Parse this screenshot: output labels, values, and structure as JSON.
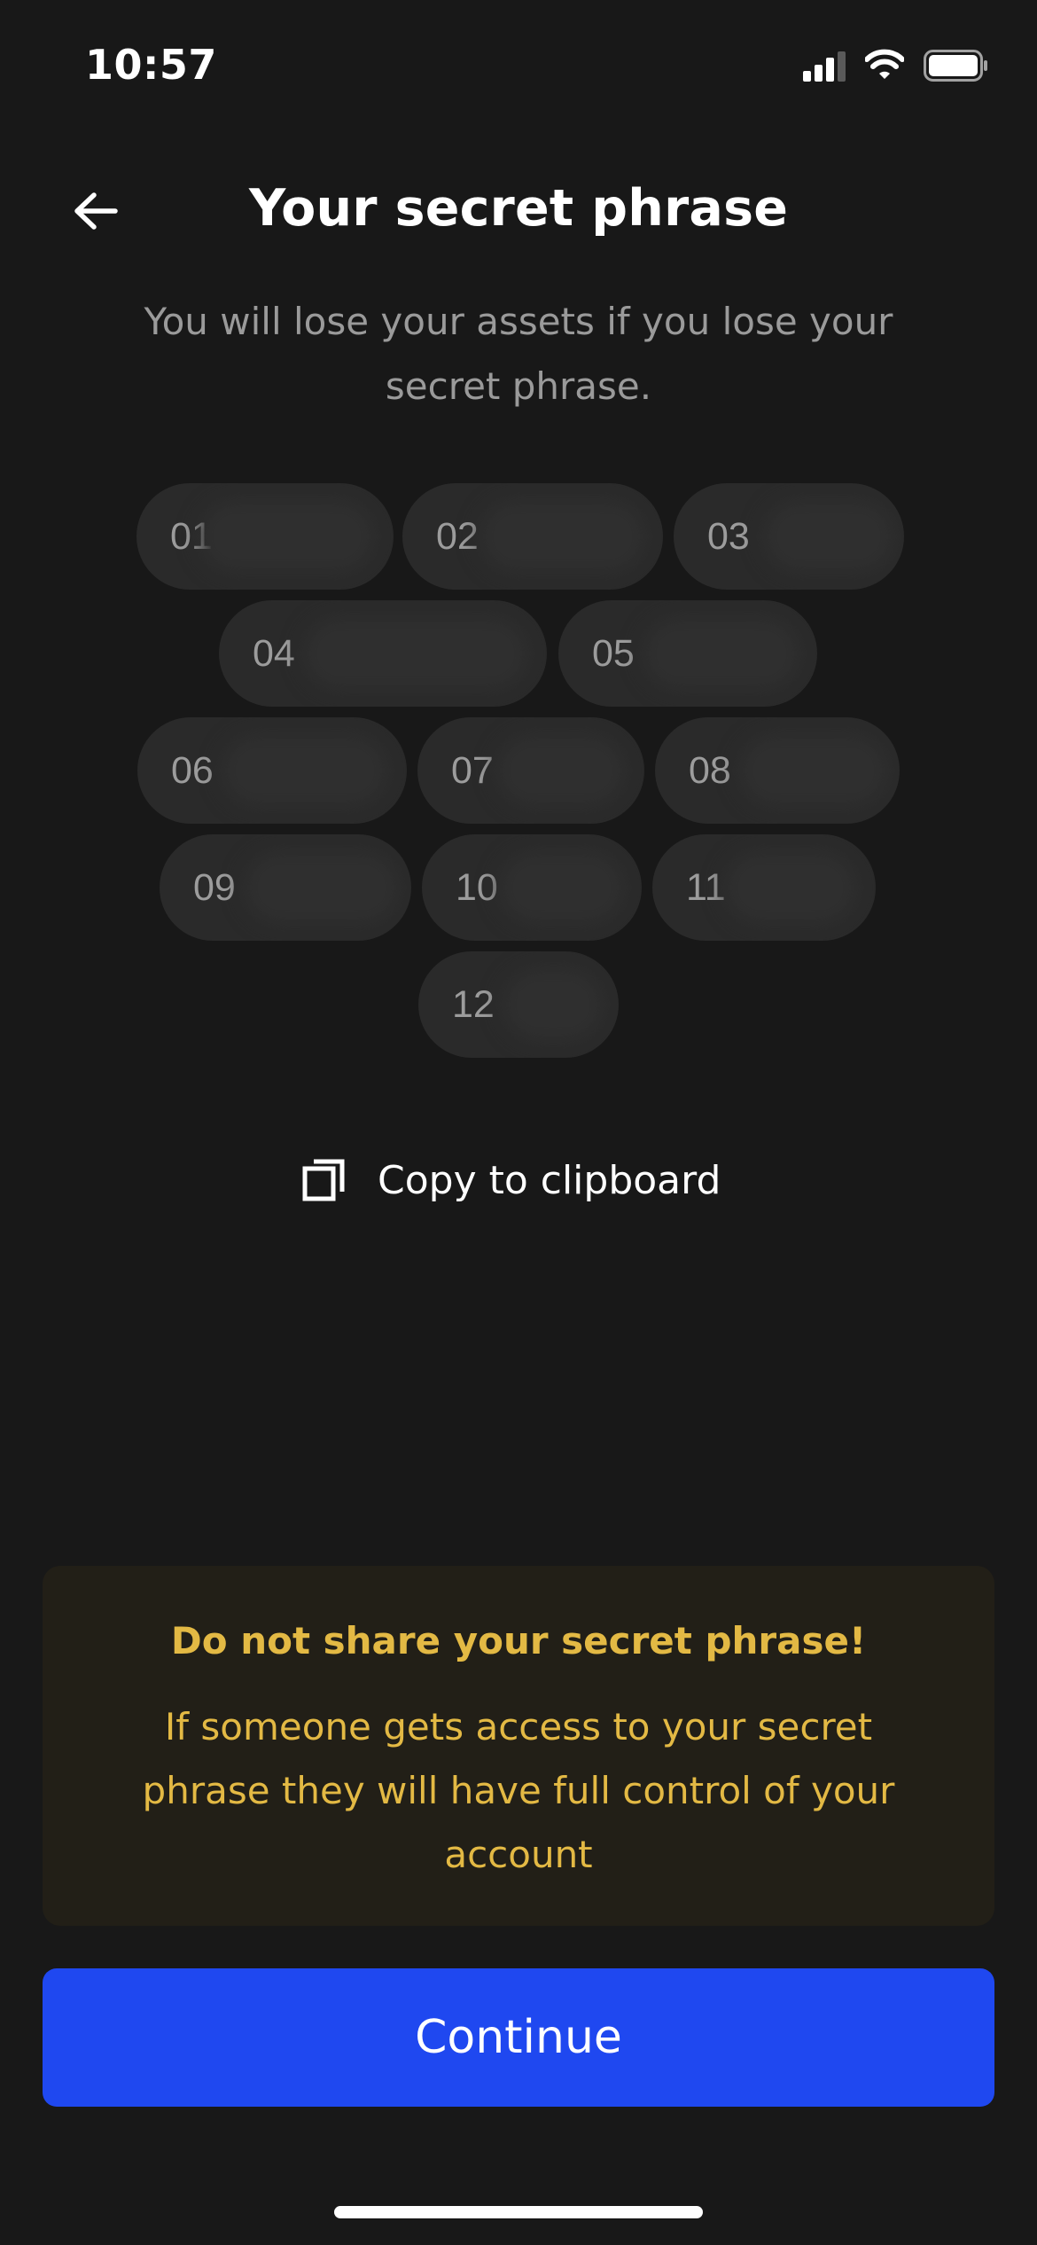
{
  "status_bar": {
    "time": "10:57",
    "icons": [
      "cellular-signal-icon",
      "wifi-icon",
      "battery-icon"
    ]
  },
  "header": {
    "back_icon": "arrow-left-icon",
    "title": "Your secret phrase"
  },
  "subtitle": "You will lose your assets if you lose your secret phrase.",
  "phrase_words": [
    {
      "number": "01"
    },
    {
      "number": "02"
    },
    {
      "number": "03"
    },
    {
      "number": "04"
    },
    {
      "number": "05"
    },
    {
      "number": "06"
    },
    {
      "number": "07"
    },
    {
      "number": "08"
    },
    {
      "number": "09"
    },
    {
      "number": "10"
    },
    {
      "number": "11"
    },
    {
      "number": "12"
    }
  ],
  "copy": {
    "icon": "copy-icon",
    "label": "Copy to clipboard"
  },
  "warning": {
    "title": "Do not share your secret phrase!",
    "body": "If someone gets access to your secret phrase they will have full control of your account"
  },
  "continue_label": "Continue",
  "colors": {
    "background": "#181818",
    "chip": "#2a2a2a",
    "warning_background": "#221f17",
    "warning_text": "#e3b944",
    "primary_button": "#1f48f0"
  }
}
